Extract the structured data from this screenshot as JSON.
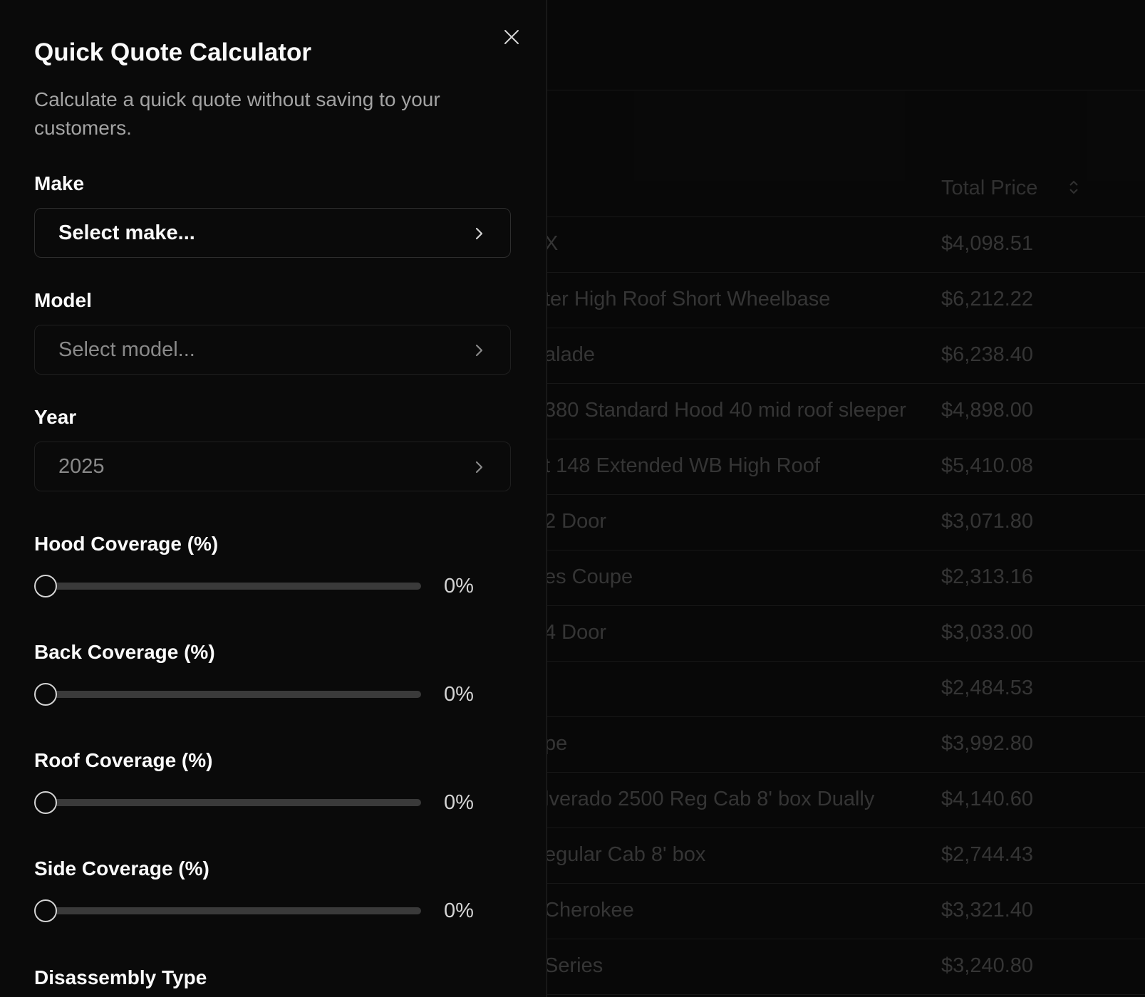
{
  "drawer": {
    "title": "Quick Quote Calculator",
    "description": "Calculate a quick quote without saving to your customers.",
    "close_icon": "close-icon",
    "make": {
      "label": "Make",
      "value": "Select make..."
    },
    "model": {
      "label": "Model",
      "value": "Select model..."
    },
    "year": {
      "label": "Year",
      "value": "2025"
    },
    "sliders": [
      {
        "label": "Hood Coverage (%)",
        "value": 0,
        "display": "0%"
      },
      {
        "label": "Back Coverage (%)",
        "value": 0,
        "display": "0%"
      },
      {
        "label": "Roof Coverage (%)",
        "value": 0,
        "display": "0%"
      },
      {
        "label": "Side Coverage (%)",
        "value": 0,
        "display": "0%"
      }
    ],
    "disassembly_label": "Disassembly Type"
  },
  "table": {
    "price_header": "Total Price",
    "rows": [
      {
        "name": "X",
        "price": "$4,098.51"
      },
      {
        "name": "ter High Roof Short Wheelbase",
        "price": "$6,212.22"
      },
      {
        "name": "alade",
        "price": "$6,238.40"
      },
      {
        "name": "380 Standard Hood 40 mid roof sleeper",
        "price": "$4,898.00"
      },
      {
        "name": "t 148 Extended WB High Roof",
        "price": "$5,410.08"
      },
      {
        "name": "2 Door",
        "price": "$3,071.80"
      },
      {
        "name": "es Coupe",
        "price": "$2,313.16"
      },
      {
        "name": "4 Door",
        "price": "$3,033.00"
      },
      {
        "name": "",
        "price": "$2,484.53"
      },
      {
        "name": "pe",
        "price": "$3,992.80"
      },
      {
        "name": "lverado 2500 Reg Cab 8' box Dually",
        "price": "$4,140.60"
      },
      {
        "name": "egular Cab 8' box",
        "price": "$2,744.43"
      },
      {
        "name": "Cherokee",
        "price": "$3,321.40"
      },
      {
        "name": "Series",
        "price": "$3,240.80"
      }
    ]
  }
}
